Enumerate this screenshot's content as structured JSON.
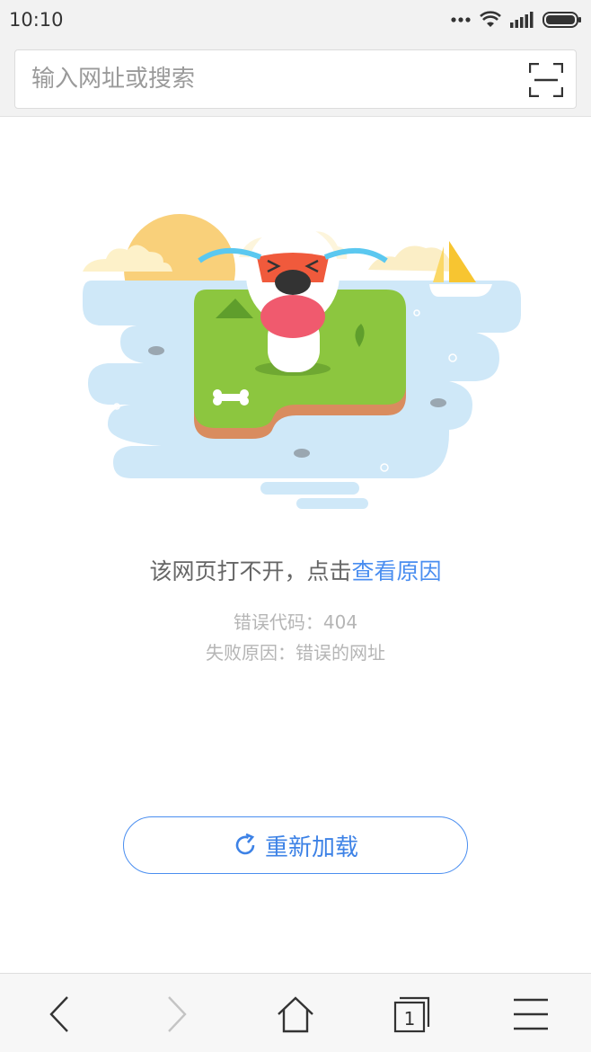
{
  "status_bar": {
    "time": "10:10",
    "icons": [
      "dots-icon",
      "wifi-icon",
      "signal-icon",
      "battery-icon"
    ]
  },
  "address_bar": {
    "placeholder": "输入网址或搜索",
    "value": "",
    "scan_icon": "scan-icon"
  },
  "error": {
    "title_prefix": "该网页打不开，点击",
    "title_link": "查看原因",
    "code_line": "错误代码：404",
    "reason_line": "失败原因：错误的网址"
  },
  "reload": {
    "label": "重新加载",
    "icon": "refresh-icon"
  },
  "bottom_nav": {
    "items": [
      {
        "name": "back",
        "icon": "chevron-left-icon",
        "enabled": true
      },
      {
        "name": "forward",
        "icon": "chevron-right-icon",
        "enabled": false
      },
      {
        "name": "home",
        "icon": "home-icon",
        "enabled": true
      },
      {
        "name": "tabs",
        "icon": "tabs-icon",
        "enabled": true
      },
      {
        "name": "menu",
        "icon": "menu-icon",
        "enabled": true
      }
    ],
    "tab_count": "1"
  },
  "colors": {
    "accent": "#4a8ef0",
    "water": "#cfe8f8",
    "grass": "#8cc63f",
    "sun": "#f9d07a"
  }
}
